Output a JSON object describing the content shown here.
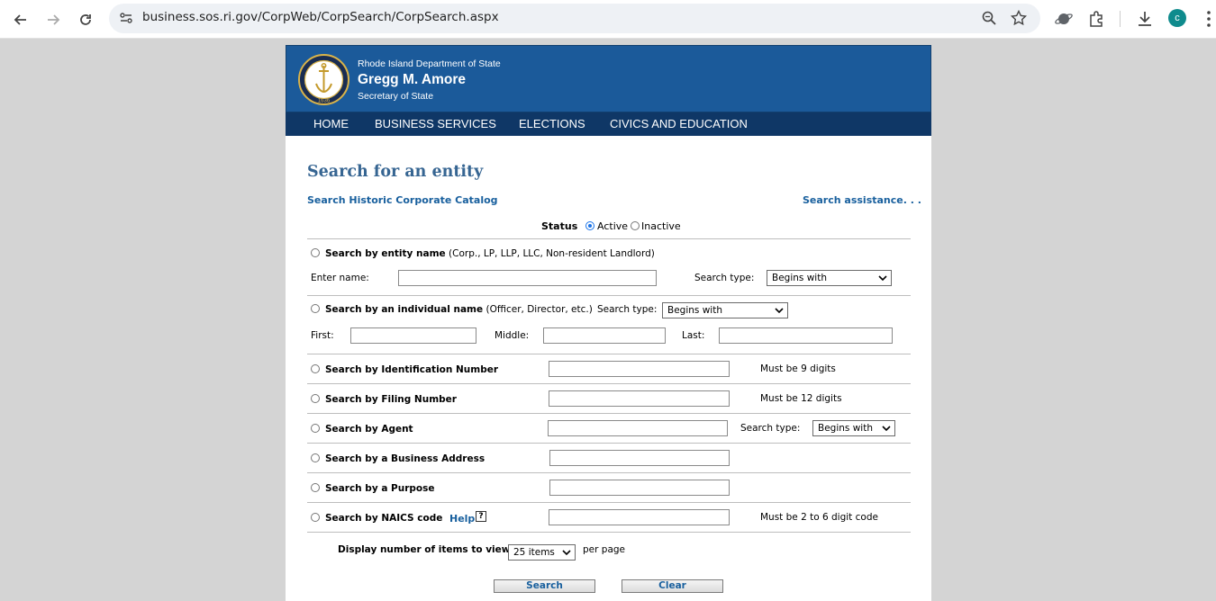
{
  "browser": {
    "url": "business.sos.ri.gov/CorpWeb/CorpSearch/CorpSearch.aspx",
    "profile_initial": "c"
  },
  "banner": {
    "department": "Rhode Island Department of State",
    "official_name": "Gregg M. Amore",
    "official_title": "Secretary of State",
    "seal_year": "1636"
  },
  "nav": {
    "items": [
      "HOME",
      "BUSINESS SERVICES",
      "ELECTIONS",
      "CIVICS AND EDUCATION"
    ]
  },
  "main": {
    "title": "Search for an entity",
    "historic_link": "Search Historic Corporate Catalog",
    "assistance_link": "Search assistance. . .",
    "status_label": "Status",
    "status_active": "Active",
    "status_inactive": "Inactive",
    "status_selected": "Active"
  },
  "entity_search": {
    "label": "Search by entity name",
    "note": "(Corp., LP, LLP, LLC, Non-resident Landlord)",
    "enter_name_label": "Enter name:",
    "name_value": "",
    "search_type_label": "Search type:",
    "search_type_value": "Begins with"
  },
  "individual_search": {
    "label": "Search by an individual name",
    "note": "(Officer, Director, etc.)",
    "search_type_label": "Search type:",
    "search_type_value": "Begins with",
    "first_label": "First:",
    "middle_label": "Middle:",
    "last_label": "Last:"
  },
  "id_search": {
    "label": "Search by Identification Number",
    "hint": "Must be 9 digits"
  },
  "filing_search": {
    "label": "Search by Filing Number",
    "hint": "Must be 12 digits"
  },
  "agent_search": {
    "label": "Search by Agent",
    "search_type_label": "Search type:",
    "search_type_value": "Begins with"
  },
  "address_search": {
    "label": "Search by a Business Address"
  },
  "purpose_search": {
    "label": "Search by a Purpose"
  },
  "naics_search": {
    "label": "Search by NAICS code",
    "help_link": "Help",
    "hint": "Must be 2 to 6 digit code"
  },
  "display": {
    "label": "Display number of items to view:",
    "items_value": "25 items",
    "suffix": "per page"
  },
  "buttons": {
    "search": "Search",
    "clear": "Clear"
  },
  "colors": {
    "banner": "#1b5a9a",
    "navbar": "#0f3766",
    "title": "#366592",
    "link": "#19609e",
    "background": "#d4d4d4"
  }
}
